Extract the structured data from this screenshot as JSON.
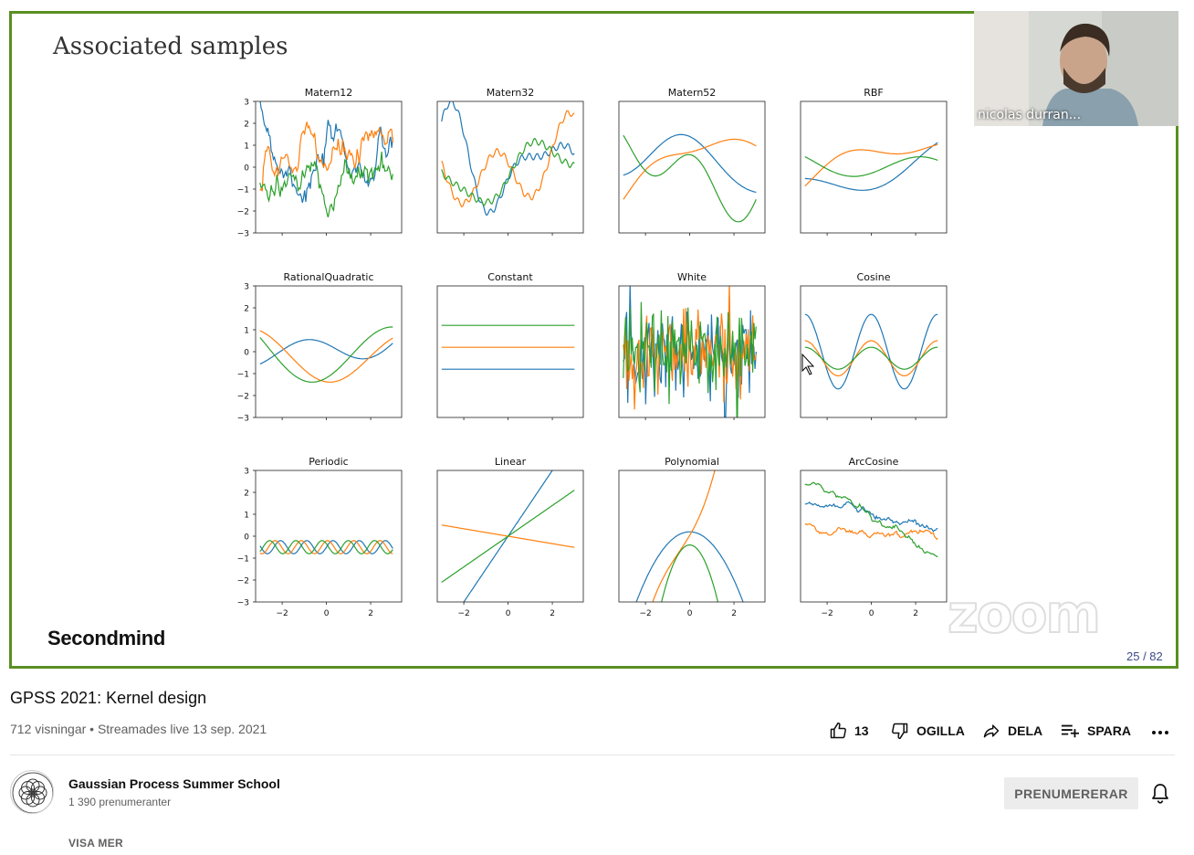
{
  "slide": {
    "title": "Associated samples",
    "brand": "Secondmind",
    "page_counter": "25 / 82",
    "webcam_name": "nicolas durran...",
    "zoom_watermark": "zoom",
    "border_color": "#5a8f22"
  },
  "chart_data": {
    "type": "line",
    "layout": "4x3 grid of subplots",
    "shared_axes": {
      "xticks": [
        -2,
        0,
        2
      ],
      "yticks": [
        -3,
        -2,
        -1,
        0,
        1,
        2,
        3
      ],
      "xlim": [
        -3.2,
        3.4
      ],
      "ylim": [
        -3,
        3
      ]
    },
    "series_colors": [
      "#1f77b4",
      "#ff7f0e",
      "#2ca02c"
    ],
    "subplots": [
      {
        "title": "Matern12",
        "kind": "rough"
      },
      {
        "title": "Matern32",
        "kind": "semi-rough"
      },
      {
        "title": "Matern52",
        "kind": "smooth-ish"
      },
      {
        "title": "RBF",
        "kind": "smooth"
      },
      {
        "title": "RationalQuadratic",
        "kind": "smooth"
      },
      {
        "title": "Constant",
        "kind": "constant",
        "values": [
          -0.8,
          0.2,
          1.2
        ]
      },
      {
        "title": "White",
        "kind": "noise"
      },
      {
        "title": "Cosine",
        "kind": "cosine"
      },
      {
        "title": "Periodic",
        "kind": "periodic"
      },
      {
        "title": "Linear",
        "kind": "linear",
        "slopes": [
          1.5,
          -0.17,
          0.7
        ]
      },
      {
        "title": "Polynomial",
        "kind": "polynomial"
      },
      {
        "title": "ArcCosine",
        "kind": "arccosine"
      }
    ]
  },
  "video": {
    "title": "GPSS 2021: Kernel design",
    "meta": "712 visningar • Streamades live 13 sep. 2021"
  },
  "actions": {
    "like_count": "13",
    "dislike_label": "OGILLA",
    "share_label": "DELA",
    "save_label": "SPARA"
  },
  "channel": {
    "name": "Gaussian Process Summer School",
    "subscribers": "1 390 prenumeranter",
    "subscribe_label": "PRENUMERERAR",
    "show_more": "VISA MER"
  }
}
